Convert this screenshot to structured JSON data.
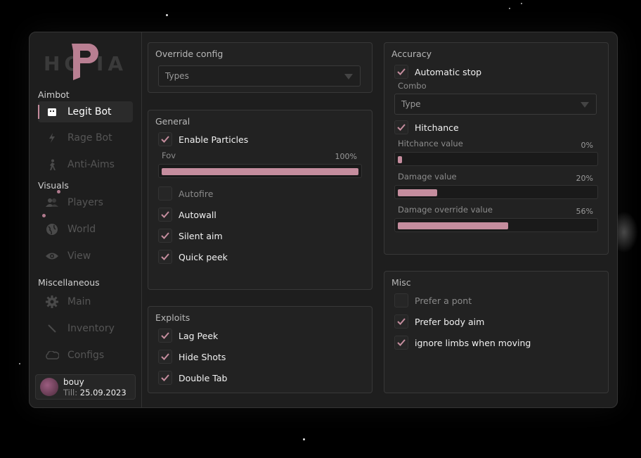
{
  "brand": {
    "logo_text": "HO  IA",
    "accent": "#c58d9e"
  },
  "sidebar": {
    "sections": [
      {
        "label": "Aimbot",
        "items": [
          {
            "label": "Legit Bot",
            "icon": "bot-icon",
            "active": true
          },
          {
            "label": "Rage Bot",
            "icon": "bolt-icon"
          },
          {
            "label": "Anti-Aims",
            "icon": "person-icon"
          }
        ]
      },
      {
        "label": "Visuals",
        "items": [
          {
            "label": "Players",
            "icon": "players-icon"
          },
          {
            "label": "World",
            "icon": "globe-icon"
          },
          {
            "label": "View",
            "icon": "eye-icon"
          }
        ]
      },
      {
        "label": "Miscellaneous",
        "items": [
          {
            "label": "Main",
            "icon": "gear-icon"
          },
          {
            "label": "Inventory",
            "icon": "knife-icon"
          },
          {
            "label": "Configs",
            "icon": "cloud-icon"
          }
        ]
      }
    ],
    "user": {
      "name": "bouy",
      "till_label": "Till:",
      "till_date": "25.09.2023"
    }
  },
  "override": {
    "title": "Override config",
    "select": "Types"
  },
  "general": {
    "title": "General",
    "enable_particles": "Enable Particles",
    "fov_label": "Fov",
    "fov_value": "100%",
    "fov_level": 1.0,
    "autofire": "Autofire",
    "autowall": "Autowall",
    "silent_aim": "Silent aim",
    "quick_peek": "Quick peek"
  },
  "exploits": {
    "title": "Exploits",
    "lag_peek": "Lag Peek",
    "hide_shots": "Hide Shots",
    "double_tab": "Double Tab"
  },
  "accuracy": {
    "title": "Accuracy",
    "automatic_stop": "Automatic stop",
    "combo_label": "Combo",
    "combo_select": "Type",
    "hitchance": "Hitchance",
    "hitchance_value_label": "Hitchance value",
    "hitchance_value": "0%",
    "hitchance_level": 0.0,
    "damage_value_label": "Damage value",
    "damage_value": "20%",
    "damage_level": 0.2,
    "damage_override_label": "Damage override value",
    "damage_override_value": "56%",
    "damage_override_level": 0.56
  },
  "misc": {
    "title": "Misc",
    "prefer_point": "Prefer a pont",
    "prefer_body_aim": "Prefer body aim",
    "ignore_limbs": "ignore limbs when moving"
  }
}
